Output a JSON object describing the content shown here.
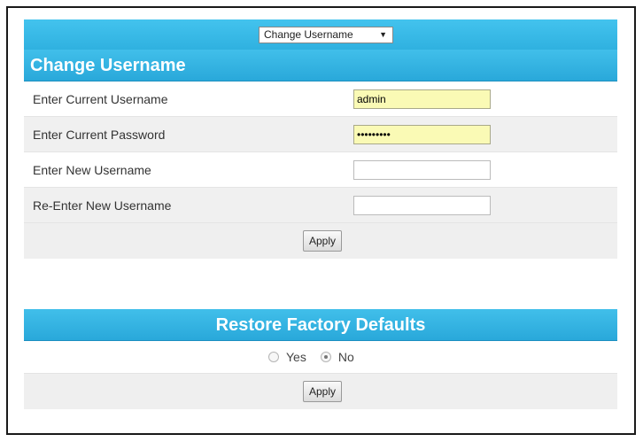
{
  "selector": {
    "value": "Change Username"
  },
  "change_username": {
    "title": "Change Username",
    "fields": [
      {
        "label": "Enter Current Username",
        "value": "admin",
        "filled": true,
        "type": "text"
      },
      {
        "label": "Enter Current Password",
        "value": "•••••••••",
        "filled": true,
        "type": "password"
      },
      {
        "label": "Enter New Username",
        "value": "",
        "filled": false,
        "type": "text"
      },
      {
        "label": "Re-Enter New Username",
        "value": "",
        "filled": false,
        "type": "text"
      }
    ],
    "apply_label": "Apply"
  },
  "restore_defaults": {
    "title": "Restore Factory Defaults",
    "options": [
      {
        "label": "Yes",
        "checked": false
      },
      {
        "label": "No",
        "checked": true
      }
    ],
    "apply_label": "Apply"
  },
  "colors": {
    "header_blue": "#3dbce8",
    "input_yellow": "#fafab5"
  }
}
